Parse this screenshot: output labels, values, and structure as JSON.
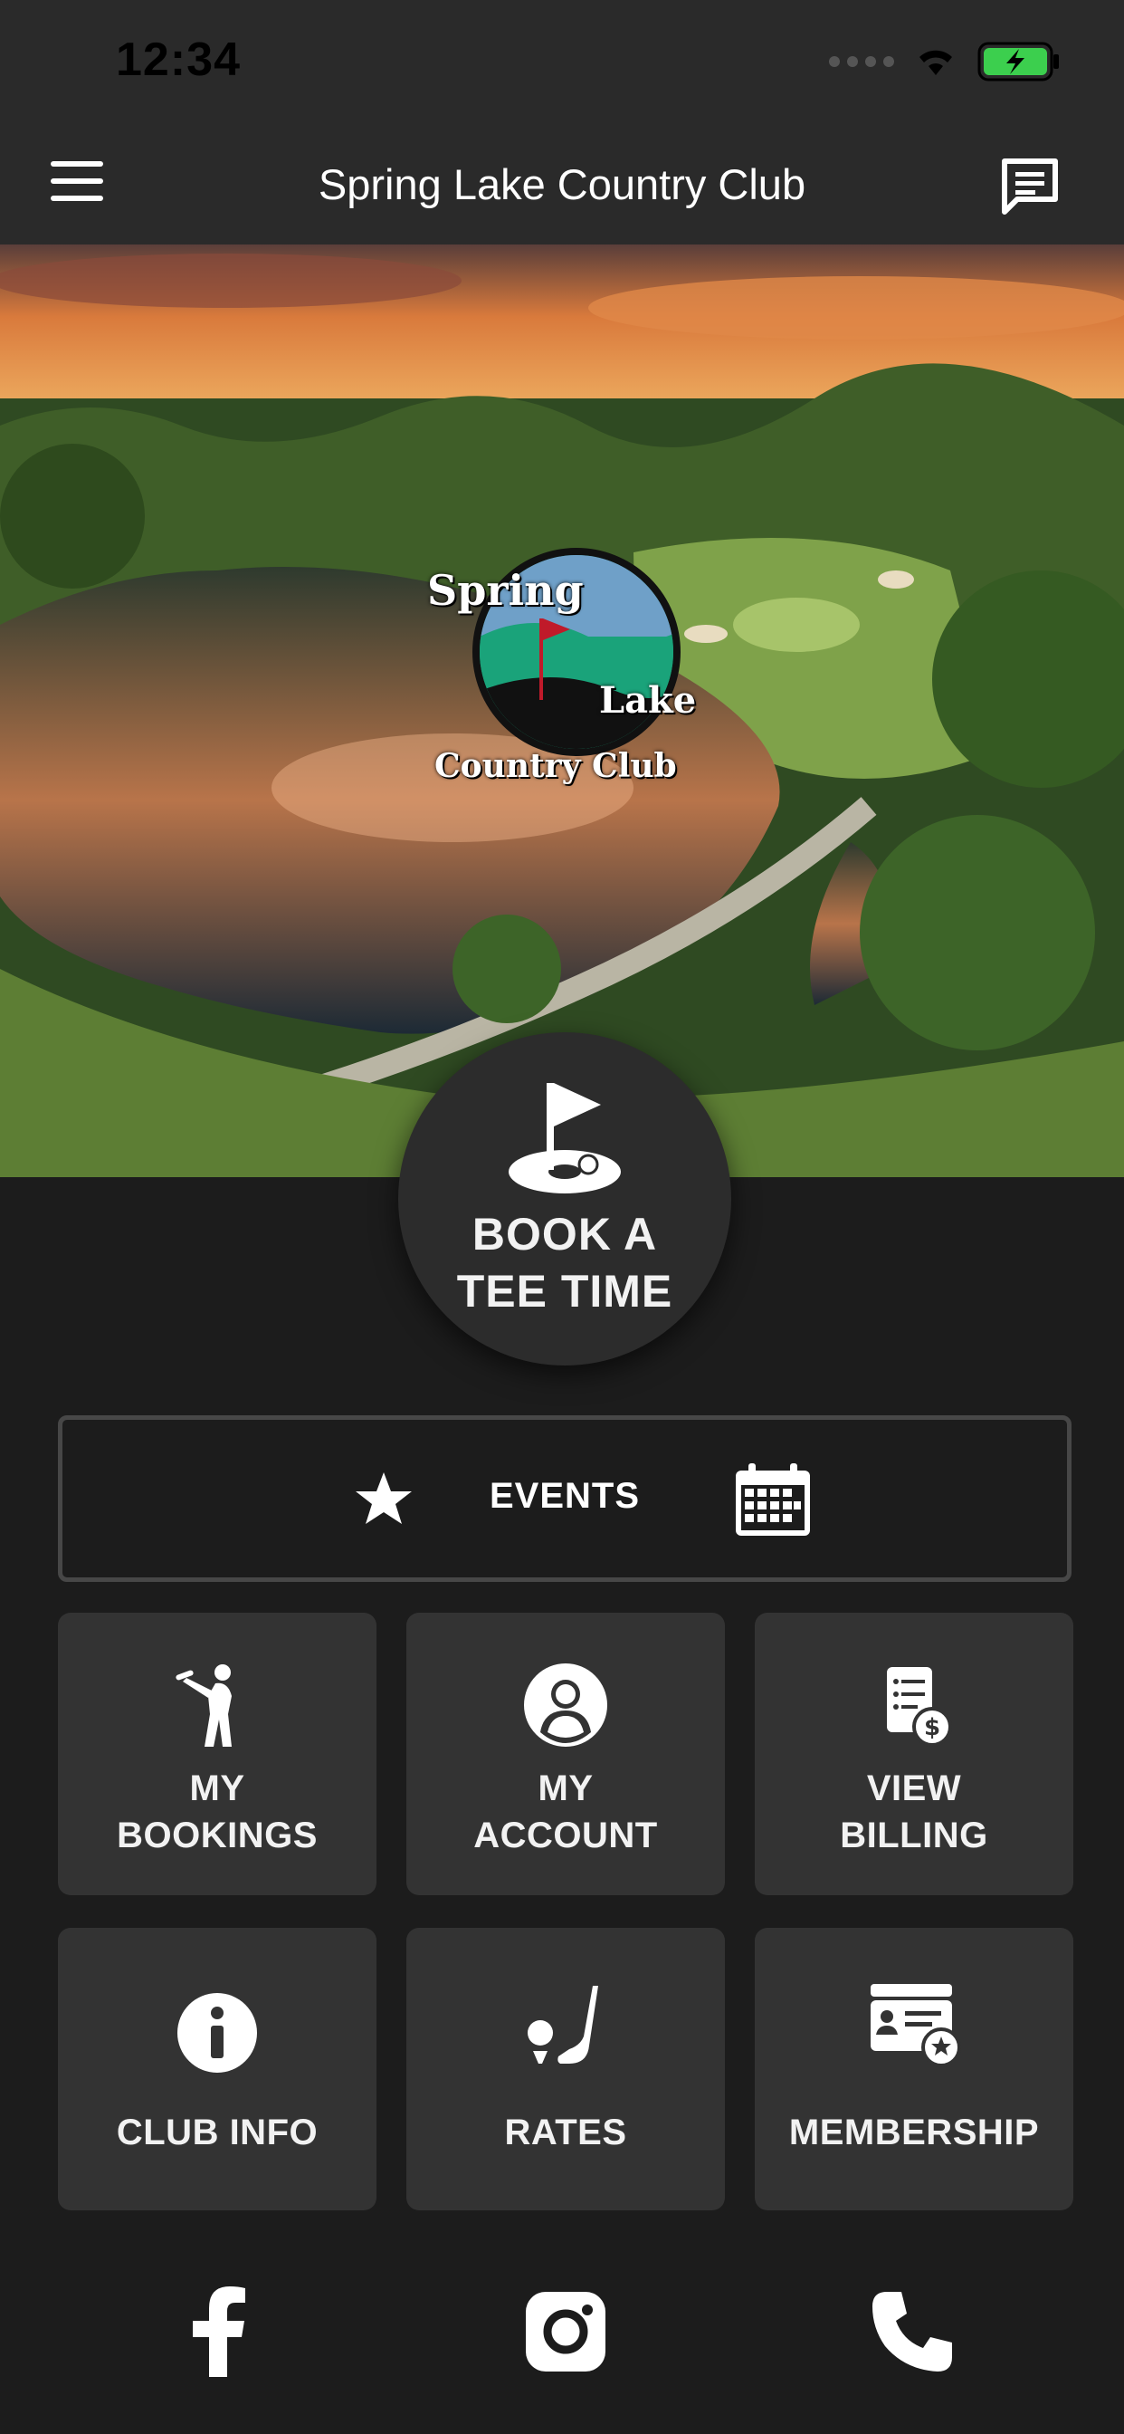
{
  "status_bar": {
    "time": "12:34"
  },
  "header": {
    "title": "Spring Lake Country Club"
  },
  "logo": {
    "line1": "Spring",
    "line2": "Lake",
    "line3": "Country Club"
  },
  "book": {
    "line1": "BOOK A",
    "line2": "TEE TIME"
  },
  "events": {
    "label": "EVENTS"
  },
  "tiles": [
    {
      "line1": "MY",
      "line2": "BOOKINGS",
      "icon": "golfer-icon"
    },
    {
      "line1": "MY",
      "line2": "ACCOUNT",
      "icon": "user-icon"
    },
    {
      "line1": "VIEW",
      "line2": "BILLING",
      "icon": "billing-icon"
    },
    {
      "line1": "CLUB INFO",
      "icon": "info-icon"
    },
    {
      "line1": "RATES",
      "icon": "golf-club-icon"
    },
    {
      "line1": "MEMBERSHIP",
      "icon": "membership-card-icon"
    }
  ],
  "social": [
    "facebook-icon",
    "instagram-icon",
    "phone-icon"
  ],
  "colors": {
    "background": "#1c1c1c",
    "tile": "#333333",
    "header": "#2a2a2a",
    "battery": "#3ccf4e"
  }
}
